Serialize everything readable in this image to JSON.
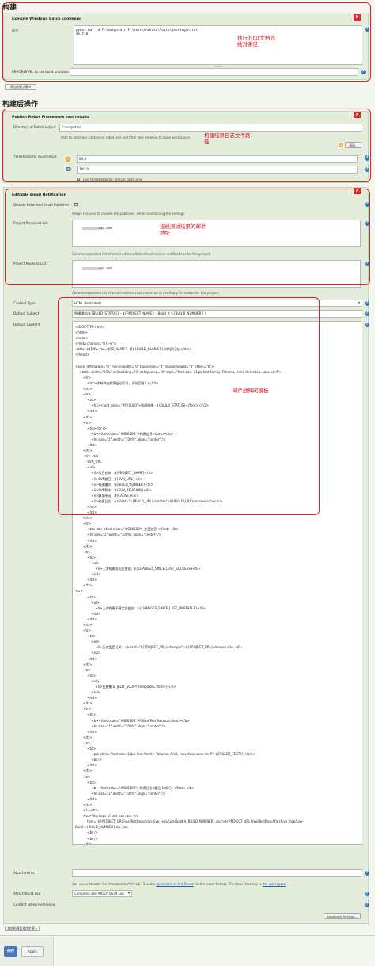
{
  "build": {
    "header": "构建",
    "step_title": "Execute Windows batch command",
    "command_label": "命令",
    "command_text": "pybot.bat -d F:\\outputdir F:\\test\\Android\\login\\testlogin.txt\nexit 0",
    "see_prefix": "参阅",
    "env_link": "可用环境变量列表",
    "errorlevel_label": "ERRORLEVEL to set build unstable",
    "add_step_button": "增加构建步骤 ▾",
    "annotation": "执行的txt文档的\n绝对路径"
  },
  "post": {
    "header": "构建后操作",
    "robot": {
      "title": "Publish Robot Framework test results",
      "dir_label": "Directory of Robot output",
      "dir_value": "F:\\outputdir",
      "dir_hint": "Path to directory containing robot.xml and html files (relative to build workspace)",
      "advanced_button": "高级...",
      "thresholds_label": "Thresholds for build result",
      "threshold_high": "80.0",
      "threshold_low": "100.0",
      "critical_only_label": "Use thresholds for critical tests only",
      "annotation": "构建结果日志文件路\n径"
    },
    "email": {
      "title": "Editable Email Notification",
      "disable_label": "Disable Extended Email Publisher",
      "disable_hint": "Allows the user to disable the publisher, while maintaining the settings",
      "recipient_label": "Project Recipient List",
      "recipient_value": "@qq.com",
      "recipient_hint": "Comma-separated list of email address that should receive notifications for this project.",
      "reply_label": "Project Reply-To List",
      "reply_value": "@qq.com",
      "reply_hint": "Comma-separated list of email address that should be in the Reply-To header for this project.",
      "annotation_recipients": "接收测试结果的邮件\n地址",
      "content_type_label": "Content Type",
      "content_type_value": "HTML (text/html)",
      "subject_label": "Default Subject",
      "subject_value": "构建通知:${BUILD_STATUS} - ${PROJECT_NAME} - Build # ${BUILD_NUMBER} !",
      "content_label": "Default Content",
      "annotation_template": "邮件通知的模板",
      "content_lines": [
        "<!DOCTYPE html>",
        "<html>",
        "<head>",
        "<meta charset=\"UTF-8\">",
        "<title>${ENV, var=\"JOB_NAME\"}-第${BUILD_NUMBER}次构建日志</title>",
        "</head>",
        "",
        "<body leftmargin=\"8\" marginwidth=\"0\" topmargin=\"8\" marginheight=\"4\" offset=\"0\">",
        "    <table width=\"95%\" cellpadding=\"0\" cellspacing=\"0\" style=\"font-size: 11pt; font-family: Tahoma, Arial, Helvetica, sans-serif\">",
        "        <tr>",
        "            <td>(本邮件由程序自动下发，请勿回复！)</td>",
        "        </tr>",
        "        <tr>",
        "            <td>",
        "                <h2><font color=\"#FF0000\">构建结果 - ${BUILD_STATUS}</font></h2>",
        "            </td>",
        "        </tr>",
        "        <tr>",
        "            <td><br />",
        "                <b><font color=\"#0B610B\">构建信息</font></b>",
        "                <hr size=\"2\" width=\"100%\" align=\"center\" />",
        "            </td>",
        "        </tr>",
        "        <tr><td>",
        "            SVN_URL",
        "            <ul>",
        "                <li>项目名称：${PROJECT_NAME}</li>",
        "                <li>SVN路径：${SVN_URL}</li>",
        "                <li>构建编号：${BUILD_NUMBER}</li>",
        "                <li>SVN版本：${SVN_REVISION}</li>",
        "                <li>触发原因：${CAUSE}</li>",
        "                <li>构建日志：<a href=\"${BUILD_URL}console\">${BUILD_URL}console</a></li>",
        "            </ul>",
        "            </td>",
        "        </tr>",
        "        <tr>",
        "            <td><b><font color=\"#0B610B\">变更信息:</font></b>",
        "            <hr size=\"2\" width=\"100%\" align=\"center\" />",
        "            </td>",
        "        </tr>",
        "        <tr>",
        "            <td>",
        "                <ul>",
        "                    <li>上次构建成功后变化：${CHANGES_SINCE_LAST_SUCCESS}</li>",
        "                </ul>",
        "            </td>",
        "        </tr>",
        "<tr>",
        "            <td>",
        "                <ul>",
        "                    <li>上次构建不稳定后变化：${CHANGES_SINCE_LAST_UNSTABLE}</li>",
        "                </ul>",
        "            </td>",
        "        </tr>",
        "        <tr>",
        "            <td>",
        "                <ul>",
        "                    <li>历史变更记录：<a href=\"${PROJECT_URL}changes\">${PROJECT_URL}changes</a></li>",
        "                </ul>",
        "            </td>",
        "        </tr>",
        "        <tr>",
        "            <td>",
        "                <ul>",
        "                    <li>变更集:${JELLY_SCRIPT,template=\"html\"}</li>",
        "                </ul>",
        "            </td>",
        "        </tr>",
        "        <tr>",
        "            <td>",
        "                <b><font color=\"#0B610B\">Failed Test Results</font></b>",
        "                <hr size=\"2\" width=\"100%\" align=\"center\" />",
        "            </td>",
        "        </tr>",
        "        <tr>",
        "            <td>",
        "                <pre style=\"font-size: 11pt; font-family: Tahoma, Arial, Helvetica, sans-serif\">${FAILED_TESTS}</pre>",
        "                <br />",
        "            </td>",
        "        </tr>",
        "        <tr>",
        "            <td>",
        "                <b><font color=\"#0B610B\">构建日志 (最后 100行):</font></b>",
        "                <hr size=\"2\" width=\"100%\" align=\"center\" />",
        "            </td>",
        "        </tr>",
        "        <!-- <tr>",
        "        <td>Test Logs (if test has ran): <a",
        "            href=\"${PROJECT_URL}ws/TestResult/archive_logs/Log-Build-${BUILD_NUMBER}.zip\">${PROJECT_URL}/ws/TestResult/archive_logs/Log-",
        "Build-${BUILD_NUMBER}.zip</a>",
        "            <br />",
        "            <br />",
        "        </td>",
        "        </tr> -->",
        "        <tr>",
        "            <td>",
        "                <textarea cols=\"80\" rows=\"30\" readonly=\"readonly\" style=\"font-family: Courier New\">${BUILD_LOG, maxLines=100,escapeHtml=true}</textarea>",
        "                <hr size=\"2\" width=\"100%\" align=\"center\" />",
        "            </td>",
        "        </tr>",
        "    </table>",
        "",
        "</body>",
        "</html>"
      ],
      "attachments_label": "Attachments",
      "attachments_hint_prefix": "Can use wildcards like 'module/dist/**/*.zip'. See the",
      "attachments_hint_link": "@includes of Ant fileset",
      "attachments_hint_mid": "for the exact format. The base directory is",
      "attachments_hint_link2": "the workspace",
      "attach_log_label": "Attach Build Log",
      "attach_log_value": "Compress and Attach Build Log",
      "content_token_label": "Content Token Reference",
      "advanced_settings_button": "Advanced Settings..."
    },
    "add_post_button": "增加构建后操作步骤 ▾"
  },
  "footer": {
    "save_button": "保存",
    "apply_button": "Apply"
  },
  "colors": {
    "accent_red": "#d2312a",
    "annotation_red": "#d6101d",
    "save_blue": "#4b78b9",
    "panel_green": "#e4eddb"
  }
}
